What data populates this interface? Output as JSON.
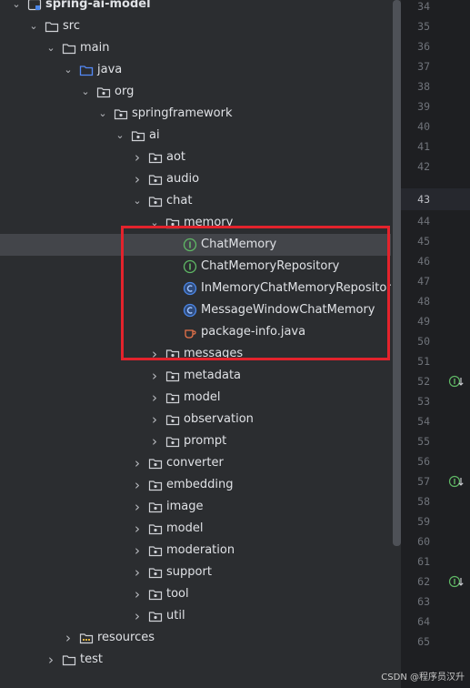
{
  "tree": [
    {
      "label": "spring-ai-model",
      "indent": 0,
      "arrow": "down",
      "icon": "module",
      "bold": true
    },
    {
      "label": "src",
      "indent": 1,
      "arrow": "down",
      "icon": "folder"
    },
    {
      "label": "main",
      "indent": 2,
      "arrow": "down",
      "icon": "folder"
    },
    {
      "label": "java",
      "indent": 3,
      "arrow": "down",
      "icon": "source-folder"
    },
    {
      "label": "org",
      "indent": 4,
      "arrow": "down",
      "icon": "package"
    },
    {
      "label": "springframework",
      "indent": 5,
      "arrow": "down",
      "icon": "package"
    },
    {
      "label": "ai",
      "indent": 6,
      "arrow": "down",
      "icon": "package"
    },
    {
      "label": "aot",
      "indent": 7,
      "arrow": "right",
      "icon": "package"
    },
    {
      "label": "audio",
      "indent": 7,
      "arrow": "right",
      "icon": "package"
    },
    {
      "label": "chat",
      "indent": 7,
      "arrow": "down",
      "icon": "package"
    },
    {
      "label": "memory",
      "indent": 8,
      "arrow": "down",
      "icon": "package"
    },
    {
      "label": "ChatMemory",
      "indent": 9,
      "arrow": "none",
      "icon": "interface",
      "selected": true
    },
    {
      "label": "ChatMemoryRepository",
      "indent": 9,
      "arrow": "none",
      "icon": "interface"
    },
    {
      "label": "InMemoryChatMemoryRepository",
      "indent": 9,
      "arrow": "none",
      "icon": "class"
    },
    {
      "label": "MessageWindowChatMemory",
      "indent": 9,
      "arrow": "none",
      "icon": "class"
    },
    {
      "label": "package-info.java",
      "indent": 9,
      "arrow": "none",
      "icon": "java-file"
    },
    {
      "label": "messages",
      "indent": 8,
      "arrow": "right",
      "icon": "package"
    },
    {
      "label": "metadata",
      "indent": 8,
      "arrow": "right",
      "icon": "package"
    },
    {
      "label": "model",
      "indent": 8,
      "arrow": "right",
      "icon": "package"
    },
    {
      "label": "observation",
      "indent": 8,
      "arrow": "right",
      "icon": "package"
    },
    {
      "label": "prompt",
      "indent": 8,
      "arrow": "right",
      "icon": "package"
    },
    {
      "label": "converter",
      "indent": 7,
      "arrow": "right",
      "icon": "package"
    },
    {
      "label": "embedding",
      "indent": 7,
      "arrow": "right",
      "icon": "package"
    },
    {
      "label": "image",
      "indent": 7,
      "arrow": "right",
      "icon": "package"
    },
    {
      "label": "model",
      "indent": 7,
      "arrow": "right",
      "icon": "package"
    },
    {
      "label": "moderation",
      "indent": 7,
      "arrow": "right",
      "icon": "package"
    },
    {
      "label": "support",
      "indent": 7,
      "arrow": "right",
      "icon": "package"
    },
    {
      "label": "tool",
      "indent": 7,
      "arrow": "right",
      "icon": "package"
    },
    {
      "label": "util",
      "indent": 7,
      "arrow": "right",
      "icon": "package"
    },
    {
      "label": "resources",
      "indent": 3,
      "arrow": "right",
      "icon": "resources-folder"
    },
    {
      "label": "test",
      "indent": 2,
      "arrow": "right",
      "icon": "folder"
    }
  ],
  "line_numbers": [
    "34",
    "35",
    "36",
    "37",
    "38",
    "39",
    "40",
    "41",
    "42",
    "43",
    "44",
    "45",
    "46",
    "47",
    "48",
    "49",
    "50",
    "51",
    "52",
    "53",
    "54",
    "55",
    "56",
    "57",
    "58",
    "59",
    "60",
    "61",
    "62",
    "63",
    "64",
    "65"
  ],
  "current_line": "43",
  "implemented_markers_at": [
    "52",
    "57",
    "62"
  ],
  "colors": {
    "highlight_box": "#e3232c",
    "interface_icon": "#5fb865",
    "class_icon": "#4a86e8",
    "java_file_icon": "#e8734a"
  },
  "watermark": "CSDN @程序员汉升"
}
